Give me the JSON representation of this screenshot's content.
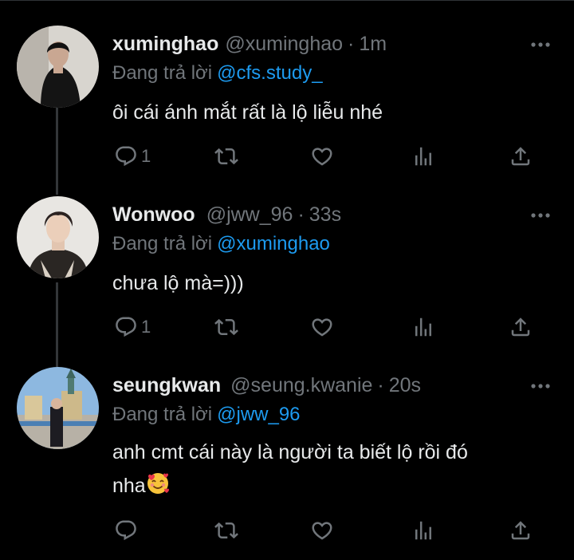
{
  "colors": {
    "background": "#000000",
    "text": "#e7e9ea",
    "muted": "#71767b",
    "link": "#1d9bf0"
  },
  "tweets": [
    {
      "name": "xuminghao",
      "handle": "@xuminghao",
      "dot": "·",
      "time": "1m",
      "replying_prefix": "Đang trả lời",
      "replying_to": "@cfs.study_",
      "text": "ôi cái ánh mắt rất là lộ liễu nhé",
      "reply_count": "1",
      "icons": [
        "reply-icon",
        "retweet-icon",
        "like-icon",
        "views-icon",
        "share-icon",
        "more-icon"
      ]
    },
    {
      "name": "Wonwoo",
      "handle": "@jww_96",
      "dot": "·",
      "time": "33s",
      "replying_prefix": "Đang trả lời",
      "replying_to": "@xuminghao",
      "text": "chưa lộ mà=)))",
      "reply_count": "1",
      "icons": [
        "reply-icon",
        "retweet-icon",
        "like-icon",
        "views-icon",
        "share-icon",
        "more-icon"
      ]
    },
    {
      "name": "seungkwan",
      "handle": "@seung.kwanie",
      "dot": "·",
      "time": "20s",
      "replying_prefix": "Đang trả lời",
      "replying_to": "@jww_96",
      "text_line1": "anh cmt cái này là người ta biết lộ rồi đó",
      "text_line2": "nha",
      "emoji": "smiling-face-with-hearts",
      "reply_count": "",
      "icons": [
        "reply-icon",
        "retweet-icon",
        "like-icon",
        "views-icon",
        "share-icon",
        "more-icon"
      ]
    }
  ]
}
